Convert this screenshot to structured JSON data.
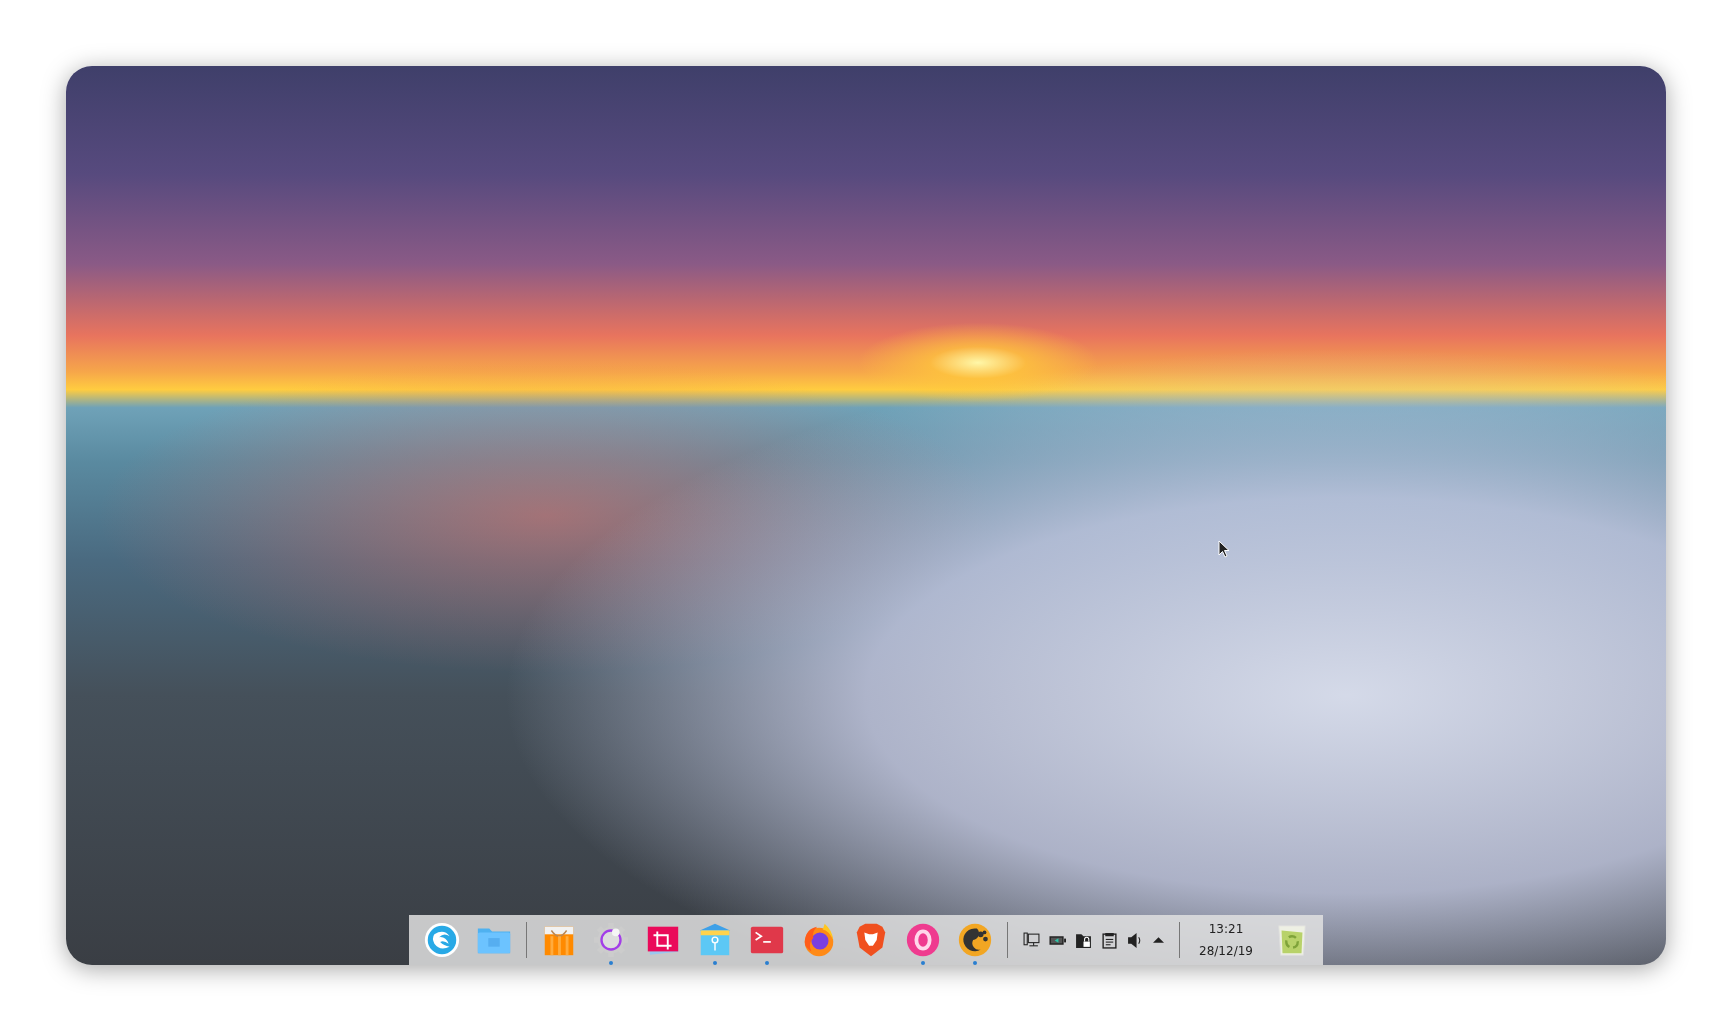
{
  "dock": {
    "groups": [
      [
        {
          "kind": "launcher",
          "running": false
        },
        {
          "kind": "files",
          "running": false
        }
      ],
      [
        {
          "kind": "store",
          "running": false
        },
        {
          "kind": "settings",
          "running": true
        },
        {
          "kind": "screenshot",
          "running": false
        },
        {
          "kind": "notes",
          "running": true
        },
        {
          "kind": "terminal",
          "running": true
        },
        {
          "kind": "firefox",
          "running": false
        },
        {
          "kind": "lion",
          "running": false
        },
        {
          "kind": "ring",
          "running": true
        },
        {
          "kind": "music",
          "running": true
        }
      ]
    ],
    "tray": [
      {
        "kind": "network"
      },
      {
        "kind": "battery"
      },
      {
        "kind": "lock"
      },
      {
        "kind": "clipboard"
      },
      {
        "kind": "volume"
      },
      {
        "kind": "expand"
      }
    ],
    "clock": {
      "time": "13:21",
      "date": "28/12/19"
    }
  }
}
